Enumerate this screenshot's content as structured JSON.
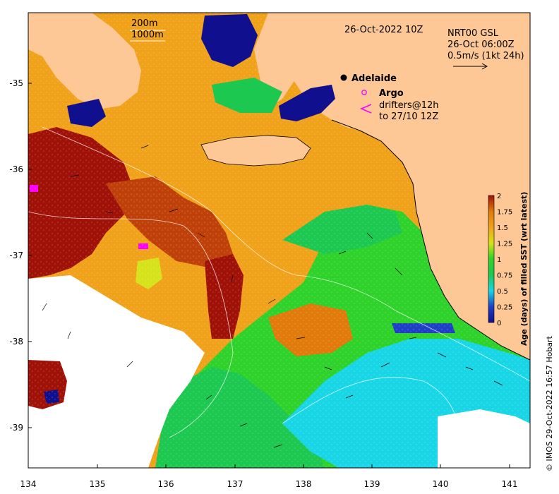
{
  "header": {
    "date": "26-Oct-2022 10Z",
    "product": "NRT00 GSL",
    "product_time": "26-Oct 06:00Z",
    "vector_scale": "0.5m/s (1kt 24h)",
    "contour_200": "200m",
    "contour_1000": "1000m"
  },
  "legend": {
    "city": "Adelaide",
    "argo": "Argo",
    "drifters_line1": "drifters@12h",
    "drifters_line2": "to 27/10 12Z"
  },
  "colorbar": {
    "title": "Age (days) of filled SST (wrt latest)",
    "ticks": [
      "0",
      "0.25",
      "0.5",
      "0.75",
      "1",
      "1.25",
      "1.5",
      "1.75",
      "2"
    ]
  },
  "credit": "© IMOS 29-Oct-2022 16:57 Hobart",
  "axes": {
    "x_ticks": [
      "134",
      "135",
      "136",
      "137",
      "138",
      "139",
      "140",
      "141"
    ],
    "y_ticks": [
      "-35",
      "-36",
      "-37",
      "-38",
      "-39"
    ],
    "lon_range": [
      134,
      141.3
    ],
    "lat_range": [
      -39.5,
      -34.2
    ]
  },
  "colors": {
    "land": "#fdc896",
    "age_0": "#10108e",
    "age_025": "#1f6fd6",
    "age_05": "#18d6e6",
    "age_075": "#1dc850",
    "age_1": "#2fd22a",
    "age_125": "#d6e21a",
    "age_15": "#f0a21a",
    "age_175": "#e07a0a",
    "age_2": "#a01208",
    "no_data": "#ffffff"
  }
}
